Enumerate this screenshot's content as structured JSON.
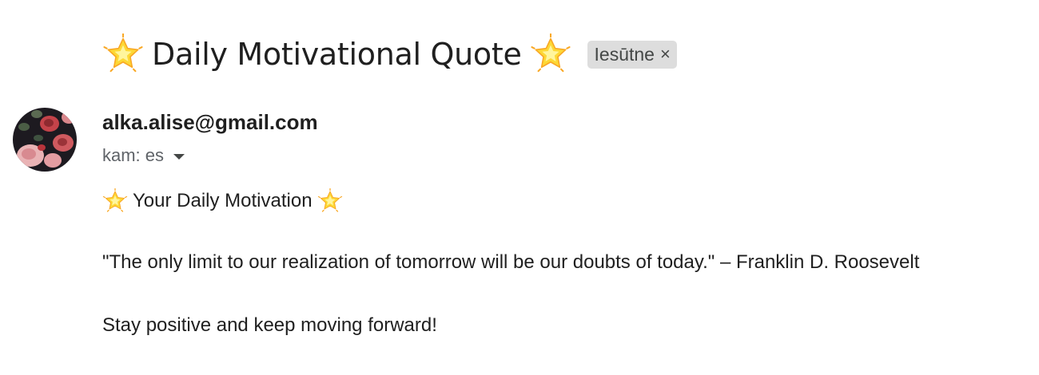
{
  "email": {
    "subject": "Daily Motivational Quote",
    "label": "Iesūtne",
    "label_remove": "×",
    "sender": "alka.alise@gmail.com",
    "recipient": "kam: es",
    "body": {
      "heading": "Your Daily Motivation",
      "quote": "\"The only limit to our realization of tomorrow will be our doubts of today.\" – Franklin D. Roosevelt",
      "closing": "Stay positive and keep moving forward!"
    }
  },
  "icons": {
    "subject_star": "glowing-star-icon",
    "body_star": "glowing-star-icon",
    "dropdown": "caret-down-icon",
    "label_close": "close-icon"
  },
  "colors": {
    "text_primary": "#1f1f1f",
    "text_secondary": "#5f6368",
    "label_background": "#dddddd",
    "star": "#fbc02d"
  }
}
